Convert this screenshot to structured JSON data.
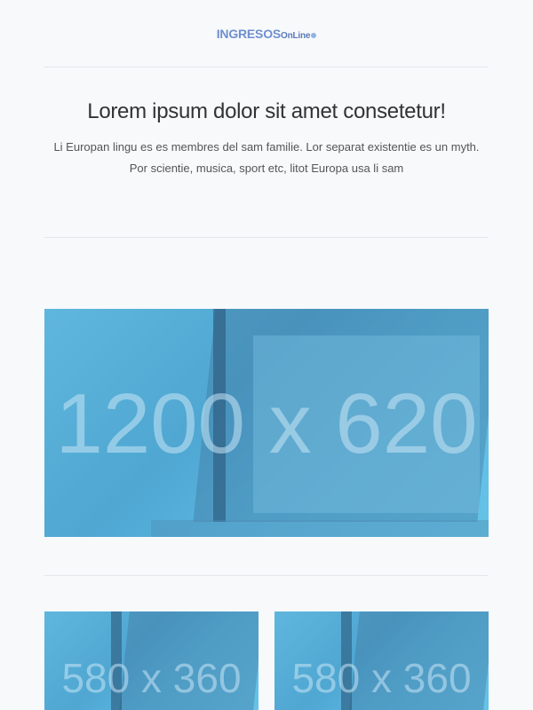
{
  "header": {
    "logo_brand": "INGRESOS",
    "logo_suffix": "OnLine"
  },
  "hero": {
    "title": "Lorem ipsum dolor sit amet consetetur!",
    "body_line1": "Li Europan lingu es es membres del sam familie. Lor separat existentie es un myth.",
    "body_line2": "Por scientie, musica, sport etc, litot Europa usa li sam"
  },
  "images": {
    "main_label": "1200 x 620",
    "left_label": "580 x 360",
    "right_label": "580 x 360"
  },
  "colors": {
    "placeholder": "#5fb6dd",
    "logo": "#6f8fd0"
  }
}
